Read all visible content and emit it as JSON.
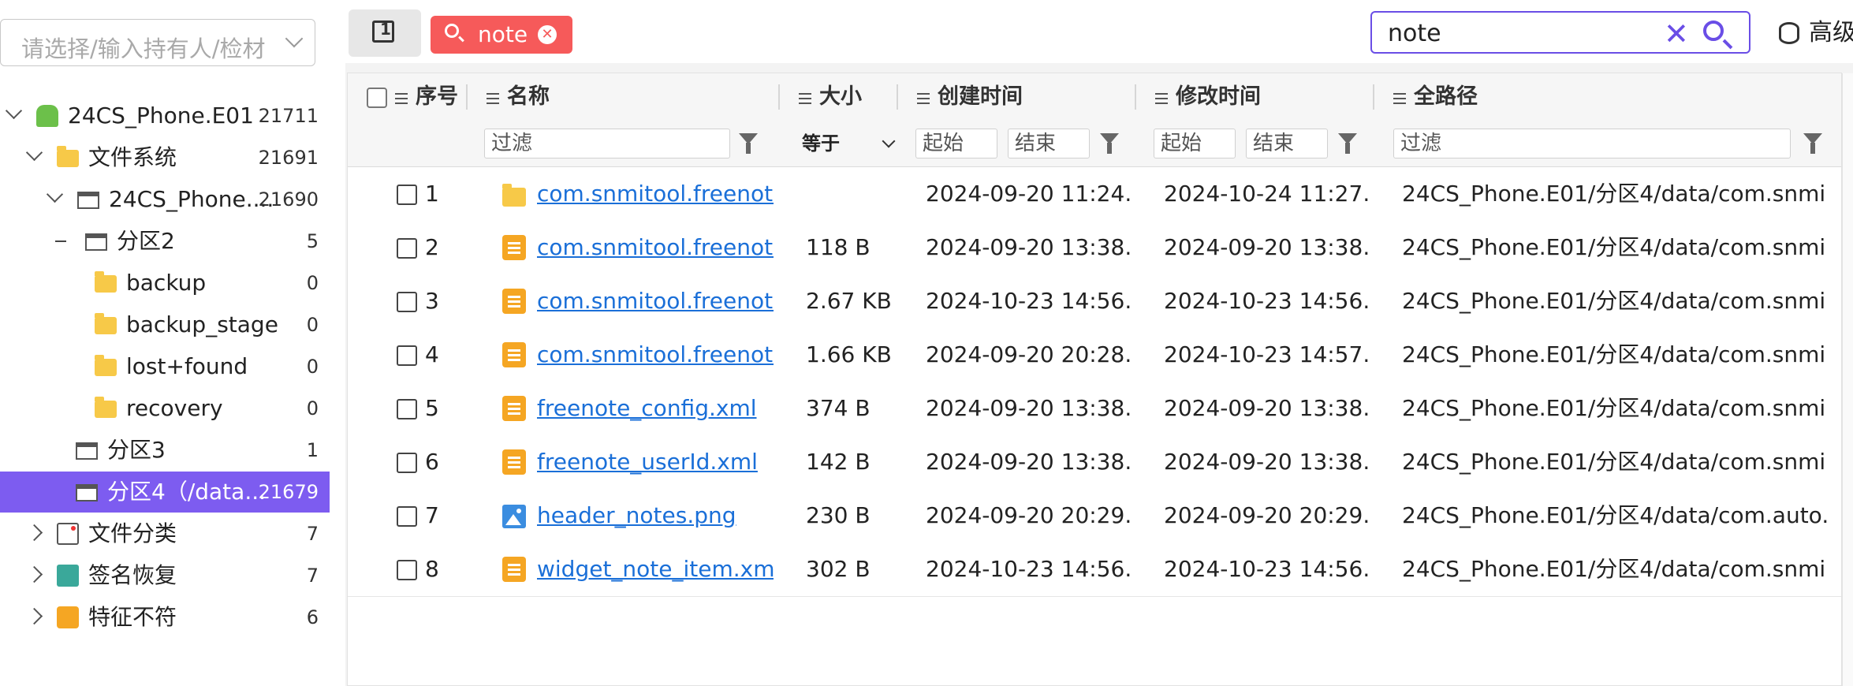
{
  "owner_select": {
    "placeholder": "请选择/输入持有人/检材"
  },
  "tree": [
    {
      "label": "24CS_Phone.E01",
      "count": "21711",
      "icon": "android-icon",
      "state": "open",
      "level": 0
    },
    {
      "label": "文件系统",
      "count": "21691",
      "icon": "folder-icon",
      "state": "open",
      "level": 1
    },
    {
      "label": "24CS_Phone....",
      "count": "21690",
      "icon": "drive-icon",
      "state": "open",
      "level": 2
    },
    {
      "label": "分区2",
      "count": "5",
      "icon": "drive-icon",
      "state": "dash",
      "level": 3
    },
    {
      "label": "backup",
      "count": "0",
      "icon": "folder-icon",
      "state": "none",
      "level": 4
    },
    {
      "label": "backup_stage",
      "count": "0",
      "icon": "folder-icon",
      "state": "none",
      "level": 4
    },
    {
      "label": "lost+found",
      "count": "0",
      "icon": "folder-icon",
      "state": "none",
      "level": 4
    },
    {
      "label": "recovery",
      "count": "0",
      "icon": "folder-icon",
      "state": "none",
      "level": 4
    },
    {
      "label": "分区3",
      "count": "1",
      "icon": "drive-icon",
      "state": "none",
      "level": 3
    },
    {
      "label": "分区4（/data...",
      "count": "21679",
      "icon": "drive-icon",
      "state": "none",
      "level": 3,
      "selected": true
    },
    {
      "label": "文件分类",
      "count": "7",
      "icon": "document-icon",
      "state": "closed",
      "level": 1
    },
    {
      "label": "签名恢复",
      "count": "7",
      "icon": "signature-icon",
      "state": "closed",
      "level": 1
    },
    {
      "label": "特征不符",
      "count": "6",
      "icon": "feature-icon",
      "state": "closed",
      "level": 1
    }
  ],
  "toolbar": {
    "tab_label": "1",
    "chip_label": "note",
    "search_value": "note",
    "advanced_label": "高级"
  },
  "columns": {
    "index": "序号",
    "name": "名称",
    "size": "大小",
    "created": "创建时间",
    "modified": "修改时间",
    "path": "全路径"
  },
  "filters": {
    "name_placeholder": "过滤",
    "size_operator": "等于",
    "created_start": "起始",
    "created_end": "结束",
    "modified_start": "起始",
    "modified_end": "结束",
    "path_placeholder": "过滤"
  },
  "rows": [
    {
      "index": "1",
      "name": "com.snmitool.freenote",
      "type": "folder",
      "size": "",
      "created": "2024-09-20 11:24...",
      "modified": "2024-10-24 11:27...",
      "path": "24CS_Phone.E01/分区4/data/com.snmi..."
    },
    {
      "index": "2",
      "name": "com.snmitool.freenote.BuglyPrefs.xml",
      "type": "xml",
      "size": "118 B",
      "created": "2024-09-20 13:38...",
      "modified": "2024-09-20 13:38...",
      "path": "24CS_Phone.E01/分区4/data/com.snmi..."
    },
    {
      "index": "3",
      "name": "com.snmitool.freenote_preferences.xml",
      "type": "xml",
      "size": "2.67 KB",
      "created": "2024-10-23 14:56...",
      "modified": "2024-10-23 14:56...",
      "path": "24CS_Phone.E01/分区4/data/com.snmi..."
    },
    {
      "index": "4",
      "name": "com.snmitool.freenote_prefs.xml",
      "type": "xml",
      "size": "1.66 KB",
      "created": "2024-09-20 20:28...",
      "modified": "2024-10-23 14:57...",
      "path": "24CS_Phone.E01/分区4/data/com.snmi..."
    },
    {
      "index": "5",
      "name": "freenote_config.xml",
      "type": "xml",
      "size": "374 B",
      "created": "2024-09-20 13:38...",
      "modified": "2024-09-20 13:38...",
      "path": "24CS_Phone.E01/分区4/data/com.snmi..."
    },
    {
      "index": "6",
      "name": "freenote_userId.xml",
      "type": "xml",
      "size": "142 B",
      "created": "2024-09-20 13:38...",
      "modified": "2024-09-20 13:38...",
      "path": "24CS_Phone.E01/分区4/data/com.snmi..."
    },
    {
      "index": "7",
      "name": "header_notes.png",
      "type": "png",
      "size": "230 B",
      "created": "2024-09-20 20:29...",
      "modified": "2024-09-20 20:29...",
      "path": "24CS_Phone.E01/分区4/data/com.auto..."
    },
    {
      "index": "8",
      "name": "widget_note_item.xml",
      "type": "xml",
      "size": "302 B",
      "created": "2024-10-23 14:56...",
      "modified": "2024-10-23 14:56...",
      "path": "24CS_Phone.E01/分区4/data/com.snmi..."
    }
  ],
  "colors": {
    "accent": "#7d5cf0",
    "chip": "#f65a5a",
    "link": "#1a6fd8",
    "folder": "#f7c948",
    "xml_file": "#f5a623",
    "image_file": "#3b8de0"
  }
}
